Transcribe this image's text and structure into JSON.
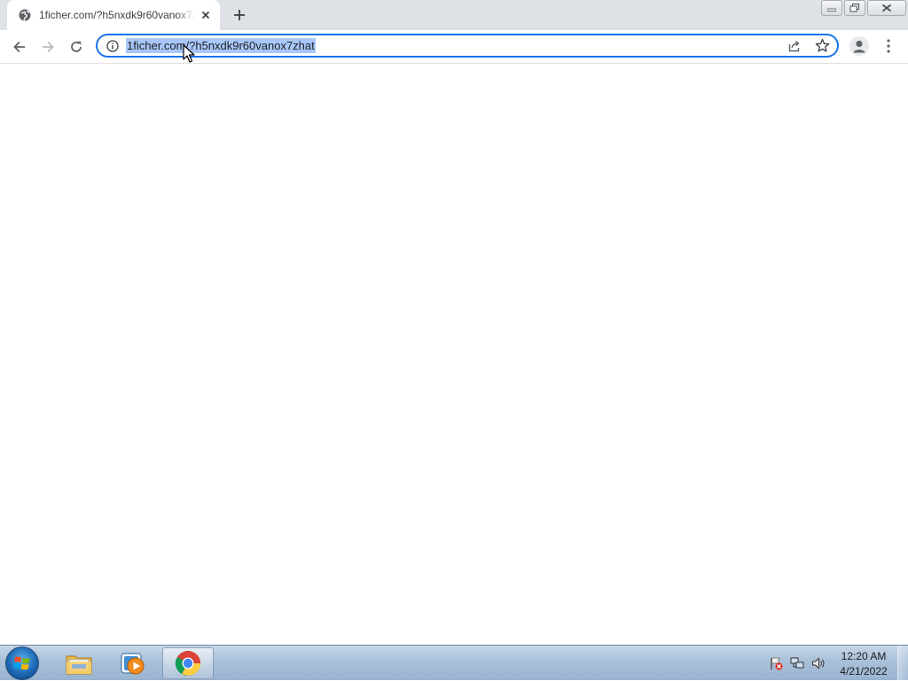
{
  "browser": {
    "tab": {
      "title": "1ficher.com/?h5nxdk9r60vanox7zhat",
      "favicon": "globe-icon",
      "close_icon": "close-icon"
    },
    "new_tab_icon": "plus-icon",
    "window_controls": [
      "minimize-icon",
      "restore-icon",
      "close-icon"
    ],
    "toolbar": {
      "back_icon": "arrow-left-icon",
      "forward_icon": "arrow-right-icon",
      "reload_icon": "reload-icon",
      "address": {
        "url": "1ficher.com/?h5nxdk9r60vanox7zhat",
        "selected": true,
        "info_icon": "info-icon",
        "share_icon": "share-icon",
        "bookmark_icon": "star-icon"
      },
      "profile_icon": "person-icon",
      "menu_icon": "kebab-menu-icon"
    },
    "page": {
      "content": ""
    }
  },
  "taskbar": {
    "start_icon": "windows-start-icon",
    "apps": [
      {
        "name": "file-explorer-icon",
        "active": false
      },
      {
        "name": "media-player-icon",
        "active": false
      },
      {
        "name": "chrome-icon",
        "active": true
      }
    ],
    "tray": [
      "action-center-icon",
      "network-icon",
      "volume-icon"
    ],
    "clock": {
      "time": "12:20 AM",
      "date": "4/21/2022"
    }
  },
  "colors": {
    "accent": "#1a73e8",
    "selection": "#a8c7fa",
    "tabstrip": "#dee1e6",
    "taskbar": "#a9c0d9"
  }
}
